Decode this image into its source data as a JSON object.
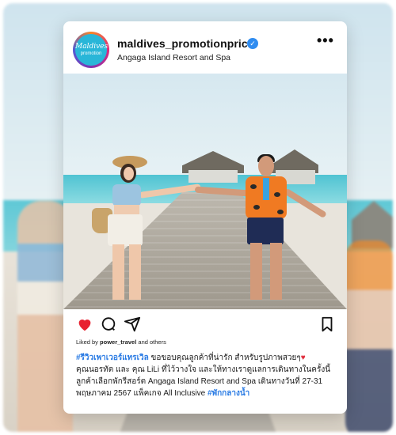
{
  "post": {
    "username": "maldives_promotionprice",
    "verified_icon": "verified-badge-icon",
    "location": "Angaga Island Resort and Spa",
    "more_label": "•••",
    "avatar": {
      "line1": "Maldives",
      "line2": "promotion"
    },
    "actions": {
      "like_icon": "heart-filled-icon",
      "comment_icon": "comment-icon",
      "share_icon": "send-icon",
      "save_icon": "bookmark-icon",
      "like_color": "#e8202f"
    },
    "liked_by": {
      "prefix": "Liked by ",
      "user": "power_travel",
      "suffix": " and others"
    },
    "caption": {
      "hashtag1": "#รีวิวเพาเวอร์แทรเวิล",
      "text1": " ขอขอบคุณลูกค้าที่น่ารัก สำหรับรูปภาพสวยๆ",
      "heart": "♥",
      "text2": "คุณนอรทัต และ คุณ LiLi ที่ไว้วางใจ และให้ทางเราดูแลการเดินทางในครั้งนี้ ลูกค้าเลือกพักรีสอร์ต Angaga Island Resort and Spa เดินทางวันที่ 27-31 พฤษภาคม 2567 แพ็คเกจ All Inclusive ",
      "hashtag2": "#พักกลางน้ำ"
    }
  },
  "colors": {
    "accent_blue": "#2a7be4",
    "verified": "#2f8cf0"
  }
}
